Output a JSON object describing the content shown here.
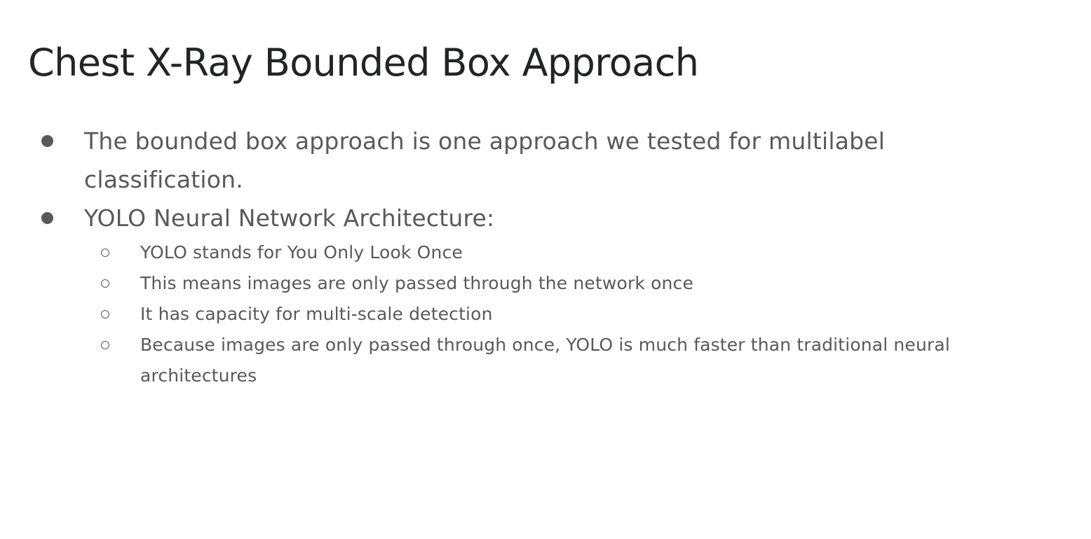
{
  "slide": {
    "title": "Chest X-Ray Bounded Box Approach",
    "bullets": [
      {
        "text": "The bounded box approach is one approach we tested for multilabel classification."
      },
      {
        "text": "YOLO Neural Network Architecture:",
        "sub_bullets": [
          "YOLO stands for You Only Look Once",
          "This means images are only passed through the network once",
          "It has capacity for multi-scale detection",
          "Because images are only passed through once, YOLO is much faster than traditional neural architectures"
        ]
      }
    ]
  },
  "colors": {
    "title": "#222426",
    "body_text": "#595959",
    "background": "#ffffff"
  },
  "icons": {
    "level1_bullet": "filled-circle-bullet-icon",
    "level2_bullet": "hollow-circle-bullet-icon"
  }
}
